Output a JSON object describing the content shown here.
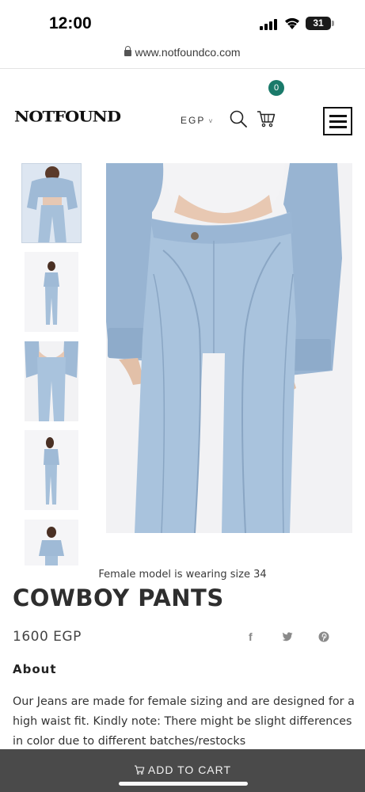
{
  "status_bar": {
    "time": "12:00",
    "battery": "31"
  },
  "browser": {
    "url": "www.notfoundco.com"
  },
  "header": {
    "logo": "NOTFOUND",
    "currency": "EGP",
    "currency_caret": "˅",
    "cart_count": "0",
    "icons": [
      "search-icon",
      "cart-icon",
      "hamburger-menu-icon"
    ]
  },
  "gallery": {
    "thumbnails": [
      "thumbnail-1",
      "thumbnail-2",
      "thumbnail-3",
      "thumbnail-4",
      "thumbnail-5"
    ],
    "caption": "Female model is wearing size 34"
  },
  "product": {
    "title": "COWBOY PANTS",
    "price": "1600 EGP",
    "share": {
      "facebook": "f",
      "twitter": "🐦",
      "pinterest": "℗"
    }
  },
  "about": {
    "heading": "About",
    "text": "Our Jeans are made for female sizing and are designed for a high waist fit. Kindly note: There might be slight differences in color due to different batches/restocks"
  },
  "cart_bar": {
    "label": "ADD TO CART",
    "icon": "cart-icon"
  },
  "colors": {
    "accent": "#1a7a6a",
    "denim": "#a9c3dd",
    "cart_bar": "#4a4a4a"
  }
}
